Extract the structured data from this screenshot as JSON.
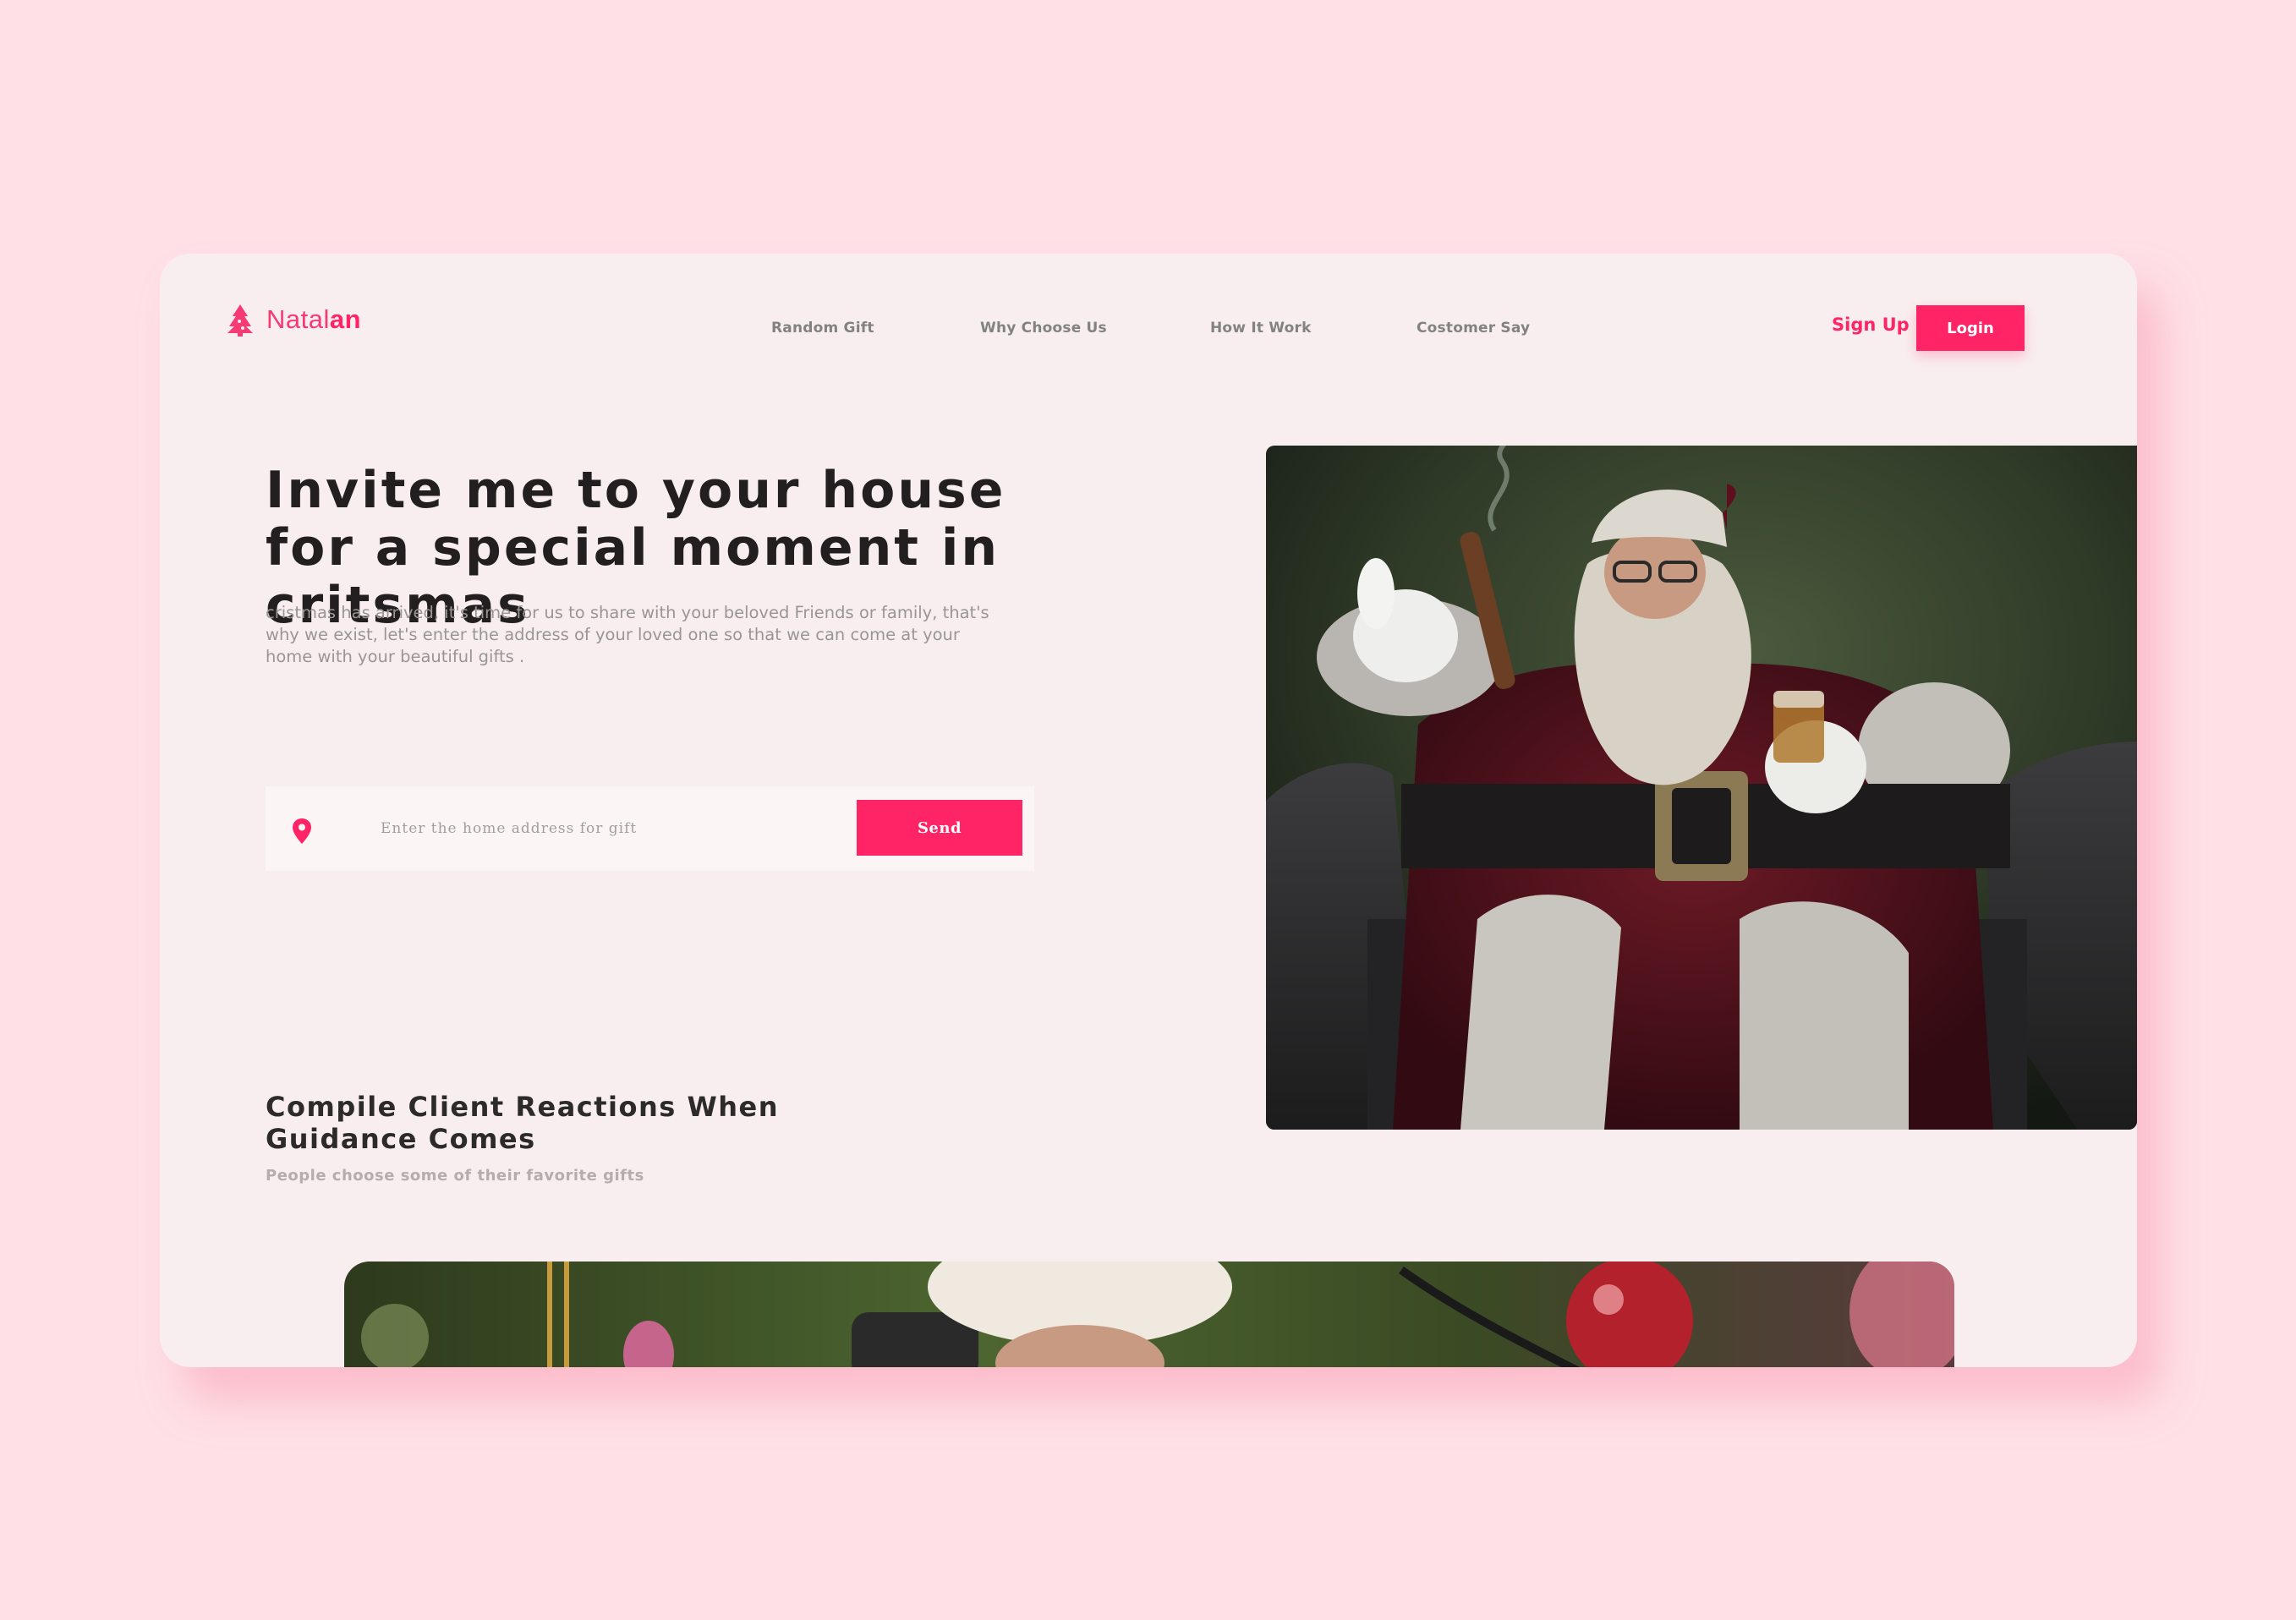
{
  "brand": {
    "name_regular": "Natal",
    "name_bold": "an",
    "accent_color": "#ff2466",
    "background_color": "#fee0e6",
    "card_color": "#f9eeef",
    "logo_icon": "christmas-tree-icon"
  },
  "nav": {
    "items": [
      {
        "label": "Random Gift"
      },
      {
        "label": "Why Choose Us"
      },
      {
        "label": "How It Work"
      },
      {
        "label": "Costomer Say"
      }
    ]
  },
  "auth": {
    "signup_label": "Sign Up",
    "login_label": "Login"
  },
  "hero": {
    "title": "Invite me to your house for a special moment in critsmas",
    "description": "cristmas has arrived, it's time for us to share with your beloved Friends or family, that's why we exist, let's enter the address of  your loved  one so that we can come at your home with your beautiful gifts .",
    "search_placeholder": "Enter the home address for gift",
    "search_icon": "location-pin-icon",
    "send_label": "Send"
  },
  "reactions": {
    "title": "Compile Client Reactions When Guidance Comes",
    "subtitle": "People choose some of their favorite gifts"
  }
}
